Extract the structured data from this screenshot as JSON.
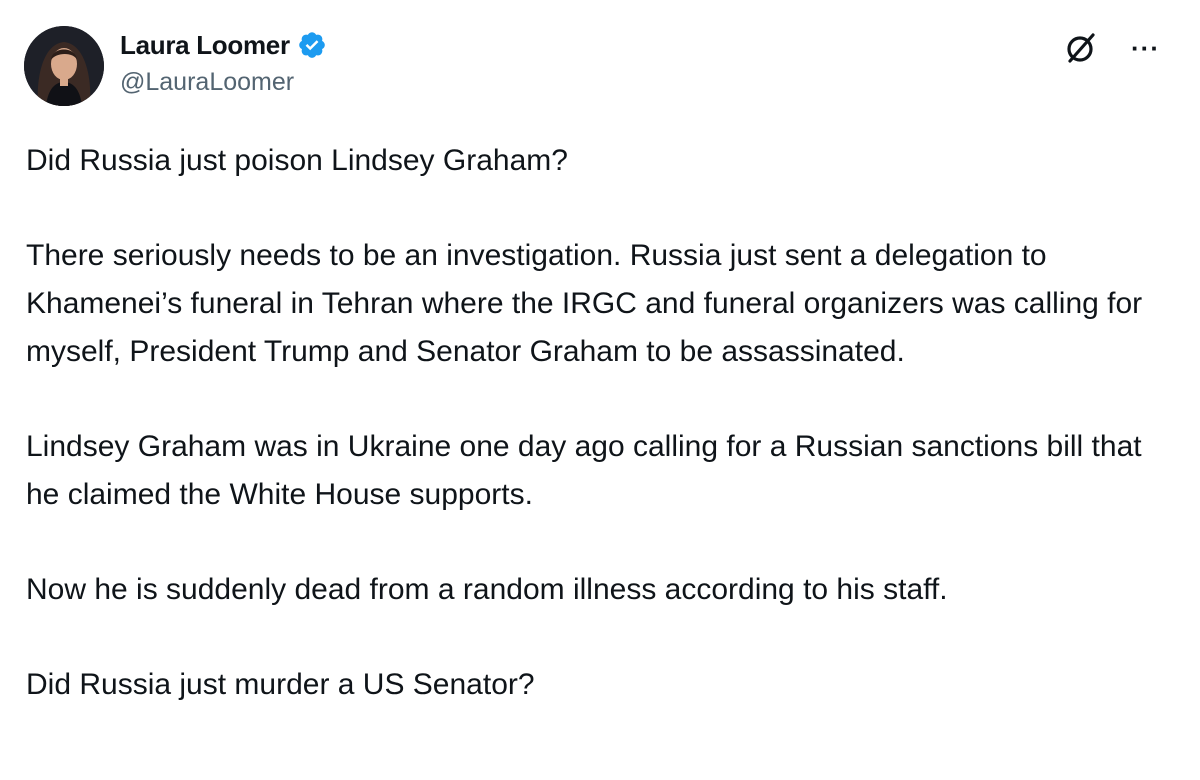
{
  "author": {
    "display_name": "Laura Loomer",
    "handle": "@LauraLoomer",
    "verified": true
  },
  "actions": {
    "grok_icon": "grok-icon",
    "more_label": "···"
  },
  "tweet": {
    "paragraphs": [
      "Did Russia just poison Lindsey Graham?",
      "There seriously needs to be an investigation. Russia just sent a delegation to Khamenei’s funeral in Tehran where the IRGC and funeral organizers was calling for myself, President Trump and Senator Graham to be assassinated.",
      "Lindsey Graham was in Ukraine one day ago calling for a Russian sanctions bill that he claimed the White House supports.",
      "Now he is suddenly dead from a random illness according to his staff.",
      "Did Russia just murder a US Senator?"
    ]
  },
  "colors": {
    "text": "#0f1419",
    "secondary": "#536471",
    "verified_blue": "#1d9bf0"
  }
}
